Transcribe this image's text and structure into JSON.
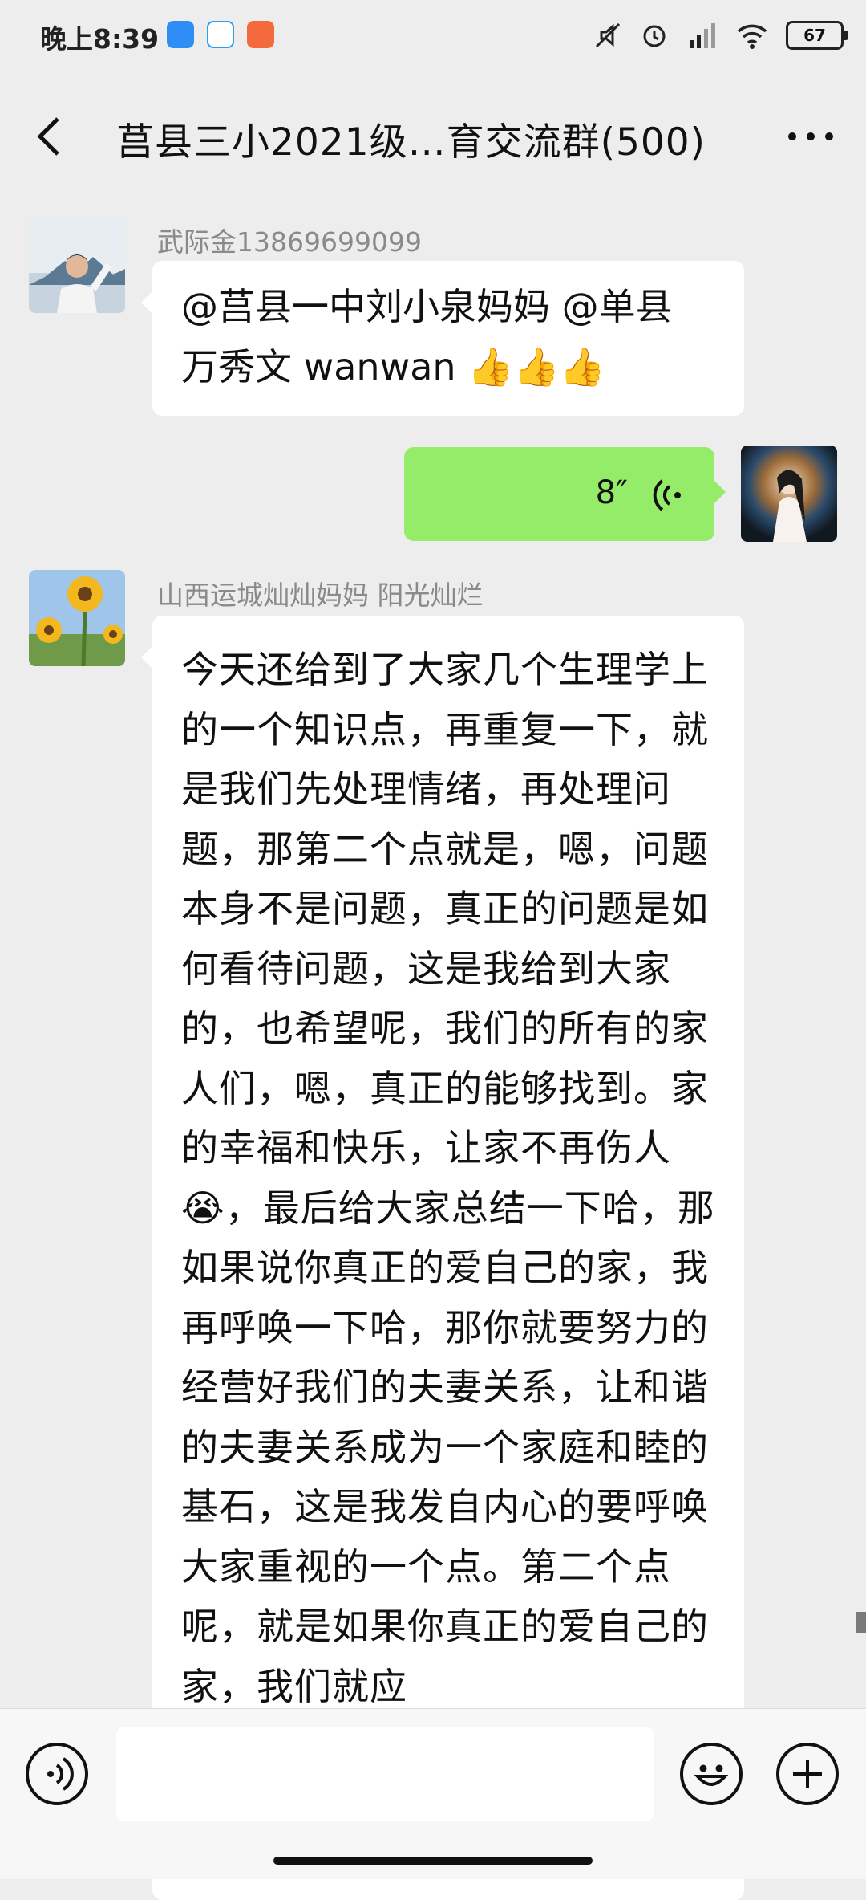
{
  "status_bar": {
    "time": "晚上8:39",
    "battery": "67"
  },
  "header": {
    "title": "莒县三小2021级…育交流群(500)"
  },
  "messages": [
    {
      "sender": "武际金13869699099",
      "text_line1": "@莒县一中刘小泉妈妈 @单县",
      "text_line2": "万秀文  wanwan",
      "emoji": "👍"
    },
    {
      "voice_duration": "8″"
    },
    {
      "sender": "山西运城灿灿妈妈  阳光灿烂",
      "text_part1": "今天还给到了大家几个生理学上的一个知识点，再重复一下，就是我们先处理情绪，再处理问题，那第二个点就是，嗯，问题本身不是问题，真正的问题是如何看待问题，这是我给到大家的，也希望呢，我们的所有的家人们，嗯，真正的能够找到。家的幸福和快乐，让家不再伤人",
      "emoji": "😭",
      "text_part2": "，最后给大家总结一下哈，那如果说你真正的爱自己的家，我再呼唤一下哈，那你就要努力的经营好我们的夫妻关系，让和谐的夫妻关系成为一个家庭和睦的基石，这是我发自内心的要呼唤大家重视的一个点。第二个点呢，就是如果你真正的爱自己的家，我们就应"
    }
  ],
  "input": {
    "value": ""
  },
  "colors": {
    "background": "#ededed",
    "bubble_self": "#95ec69",
    "bubble_other": "#ffffff"
  }
}
